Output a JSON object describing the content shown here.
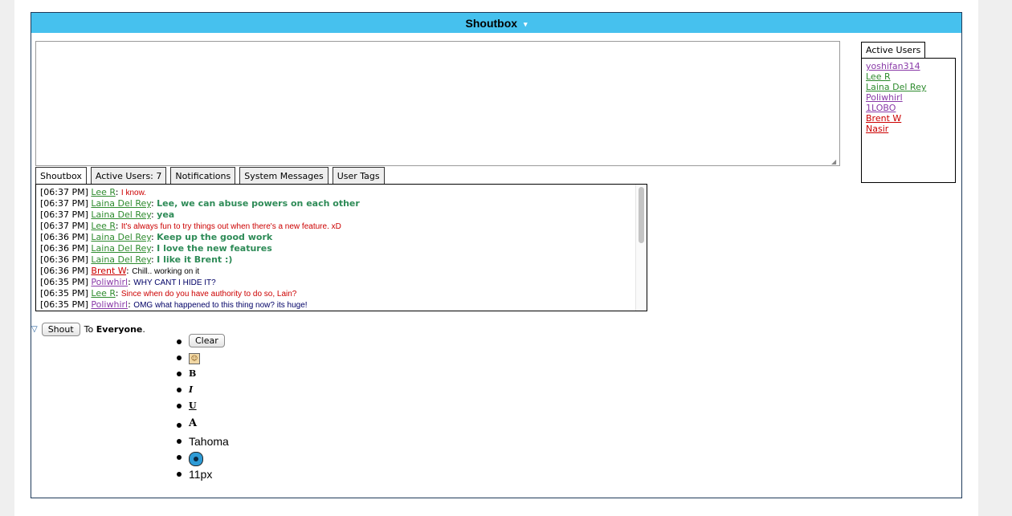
{
  "header": {
    "title": "Shoutbox",
    "caret": "▾"
  },
  "tabs": [
    {
      "label": "Shoutbox"
    },
    {
      "label": "Active Users: 7"
    },
    {
      "label": "Notifications"
    },
    {
      "label": "System Messages"
    },
    {
      "label": "User Tags"
    }
  ],
  "messages": [
    {
      "time": "[06:37 PM]",
      "user": "Lee R",
      "user_color": "#2e8b2e",
      "text": "I know.",
      "text_color": "#cc0000",
      "bold": false
    },
    {
      "time": "[06:37 PM]",
      "user": "Laina Del Rey",
      "user_color": "#2e8b2e",
      "text": "Lee, we can abuse powers on each other",
      "text_color": "#2e8b57",
      "bold": true
    },
    {
      "time": "[06:37 PM]",
      "user": "Laina Del Rey",
      "user_color": "#2e8b2e",
      "text": "yea",
      "text_color": "#2e8b57",
      "bold": true
    },
    {
      "time": "[06:37 PM]",
      "user": "Lee R",
      "user_color": "#2e8b2e",
      "text": "It's always fun to try things out when there's a new feature. xD",
      "text_color": "#cc0000",
      "bold": false
    },
    {
      "time": "[06:36 PM]",
      "user": "Laina Del Rey",
      "user_color": "#2e8b2e",
      "text": "Keep up the good work",
      "text_color": "#2e8b57",
      "bold": true
    },
    {
      "time": "[06:36 PM]",
      "user": "Laina Del Rey",
      "user_color": "#2e8b2e",
      "text": "I love the new features",
      "text_color": "#2e8b57",
      "bold": true
    },
    {
      "time": "[06:36 PM]",
      "user": "Laina Del Rey",
      "user_color": "#2e8b2e",
      "text": "I like it Brent :)",
      "text_color": "#2e8b57",
      "bold": true
    },
    {
      "time": "[06:36 PM]",
      "user": "Brent W",
      "user_color": "#cc0000",
      "text": "Chill.. working on it",
      "text_color": "#000000",
      "bold": false
    },
    {
      "time": "[06:35 PM]",
      "user": "Poliwhirl",
      "user_color": "#8a3aa8",
      "text": "WHY CANT I HIDE IT?",
      "text_color": "#000066",
      "bold": false
    },
    {
      "time": "[06:35 PM]",
      "user": "Lee R",
      "user_color": "#2e8b2e",
      "text": "Since when do you have authority to do so, Lain?",
      "text_color": "#cc0000",
      "bold": false
    },
    {
      "time": "[06:35 PM]",
      "user": "Poliwhirl",
      "user_color": "#8a3aa8",
      "text": "OMG what happened to this thing now? its huge!",
      "text_color": "#000066",
      "bold": false
    }
  ],
  "active_users": {
    "tab_label": "Active Users",
    "users": [
      {
        "name": "yoshifan314",
        "color": "#8a3aa8"
      },
      {
        "name": "Lee R",
        "color": "#2e8b2e"
      },
      {
        "name": "Laina Del Rey",
        "color": "#2e8b2e"
      },
      {
        "name": "Poliwhirl",
        "color": "#8a3aa8"
      },
      {
        "name": "1LOBO",
        "color": "#8a3aa8"
      },
      {
        "name": "Brent W",
        "color": "#cc0000"
      },
      {
        "name": "Nasir",
        "color": "#cc0000"
      }
    ]
  },
  "shout": {
    "button_label": "Shout",
    "to_prefix": "To",
    "target": "Everyone",
    "target_suffix": "."
  },
  "tools": {
    "clear_label": "Clear",
    "bold_label": "B",
    "italic_label": "I",
    "underline_label": "U",
    "font_icon_label": "A",
    "font_family": "Tahoma",
    "font_size": "11px",
    "icons": [
      "smiley-icon",
      "sound-icon"
    ]
  }
}
